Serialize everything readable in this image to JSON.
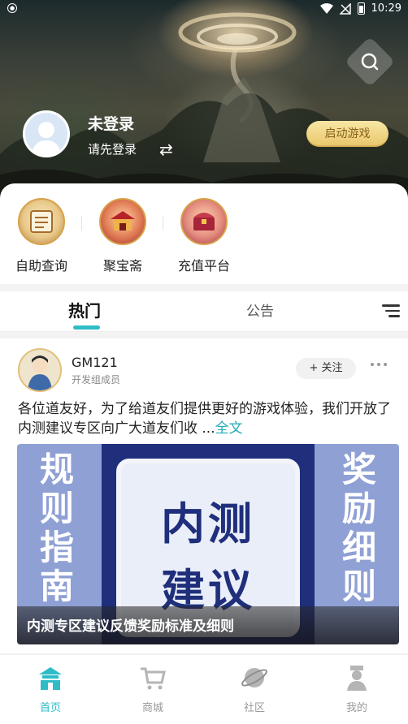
{
  "status_bar": {
    "time": "10:29"
  },
  "profile": {
    "title": "未登录",
    "subtitle": "请先登录",
    "switch_icon": "swap-icon"
  },
  "start_game": "启动游戏",
  "shortcuts": [
    {
      "label": "自助查询",
      "icon": "scroll-icon"
    },
    {
      "label": "聚宝斋",
      "icon": "treasure-pavilion-icon"
    },
    {
      "label": "充值平台",
      "icon": "treasure-chest-icon"
    }
  ],
  "tabs": [
    {
      "label": "热门",
      "active": true
    },
    {
      "label": "公告",
      "active": false
    }
  ],
  "post": {
    "author": "GM121",
    "role": "开发组成员",
    "follow_label": "+ 关注",
    "text": "各位道友好，为了给道友们提供更好的游戏体验，我们开放了内测建议专区向广大道友们收 ...",
    "more_link": "全文",
    "banner": {
      "left_text": "规则指南",
      "center_line1": "内测",
      "center_line2": "建议",
      "right_text": "奖励细则",
      "caption": "内测专区建议反馈奖励标准及细则"
    }
  },
  "bottom_nav": [
    {
      "label": "首页",
      "active": true
    },
    {
      "label": "商城",
      "active": false
    },
    {
      "label": "社区",
      "active": false
    },
    {
      "label": "我的",
      "active": false
    }
  ],
  "colors": {
    "accent": "#2ebcc7",
    "start_button": "#e8c76a"
  }
}
